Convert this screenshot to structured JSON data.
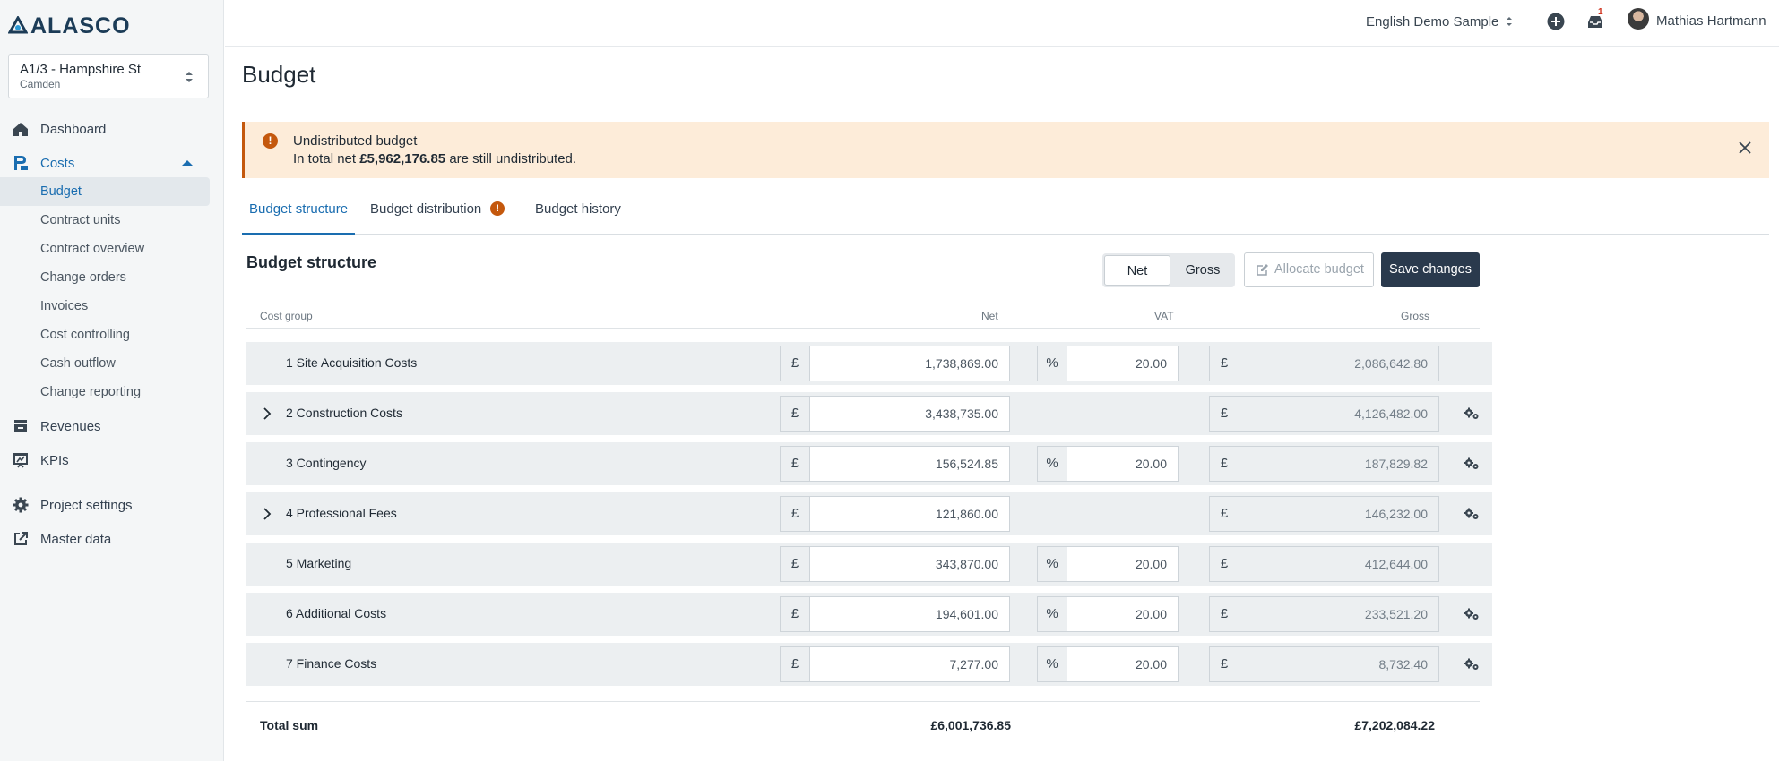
{
  "brand": {
    "name": "ALASCO"
  },
  "project": {
    "name": "A1/3 - Hampshire St",
    "location": "Camden"
  },
  "nav": {
    "items": [
      {
        "label": "Dashboard"
      },
      {
        "label": "Costs"
      },
      {
        "label": "Revenues"
      },
      {
        "label": "KPIs"
      },
      {
        "label": "Project settings"
      },
      {
        "label": "Master data"
      }
    ],
    "costs_sub": [
      {
        "label": "Budget"
      },
      {
        "label": "Contract units"
      },
      {
        "label": "Contract overview"
      },
      {
        "label": "Change orders"
      },
      {
        "label": "Invoices"
      },
      {
        "label": "Cost controlling"
      },
      {
        "label": "Cash outflow"
      },
      {
        "label": "Change reporting"
      }
    ]
  },
  "header": {
    "company": "English Demo Sample",
    "notification_count": "1",
    "user_name": "Mathias Hartmann"
  },
  "page": {
    "title": "Budget"
  },
  "alert": {
    "title": "Undistributed budget",
    "text_before": "In total net ",
    "amount": "£5,962,176.85",
    "text_after": " are still undistributed."
  },
  "tabs": [
    {
      "label": "Budget structure"
    },
    {
      "label": "Budget distribution"
    },
    {
      "label": "Budget history"
    }
  ],
  "section": {
    "title": "Budget structure",
    "toggle_net": "Net",
    "toggle_gross": "Gross",
    "allocate_label": "Allocate budget",
    "save_label": "Save changes"
  },
  "table": {
    "headers": {
      "cost_group": "Cost group",
      "net": "Net",
      "vat": "VAT",
      "gross": "Gross"
    },
    "currency_symbol": "£",
    "percent_symbol": "%",
    "rows": [
      {
        "label": "1 Site Acquisition Costs",
        "net": "1,738,869.00",
        "vat": "20.00",
        "gross": "2,086,642.80"
      },
      {
        "label": "2 Construction Costs",
        "net": "3,438,735.00",
        "vat": "",
        "gross": "4,126,482.00"
      },
      {
        "label": "3 Contingency",
        "net": "156,524.85",
        "vat": "20.00",
        "gross": "187,829.82"
      },
      {
        "label": "4 Professional Fees",
        "net": "121,860.00",
        "vat": "",
        "gross": "146,232.00"
      },
      {
        "label": "5 Marketing",
        "net": "343,870.00",
        "vat": "20.00",
        "gross": "412,644.00"
      },
      {
        "label": "6 Additional Costs",
        "net": "194,601.00",
        "vat": "20.00",
        "gross": "233,521.20"
      },
      {
        "label": "7 Finance Costs",
        "net": "7,277.00",
        "vat": "20.00",
        "gross": "8,732.40"
      }
    ],
    "total": {
      "label": "Total sum",
      "net": "£6,001,736.85",
      "gross": "£7,202,084.22"
    }
  },
  "colors": {
    "accent": "#1a6db0",
    "warning": "#c4580d",
    "dark_button": "#2a3a4d"
  }
}
